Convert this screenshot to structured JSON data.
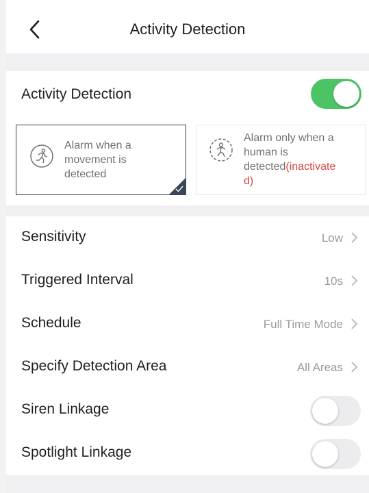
{
  "header": {
    "title": "Activity Detection",
    "back_icon": "chevron-left-icon"
  },
  "activity_detection": {
    "label": "Activity Detection",
    "enabled": true,
    "toggle_color": "#4cc466",
    "modes": [
      {
        "text_line1": "Alarm when a",
        "text_line2": "movement is",
        "text_line3": "detected",
        "selected": true,
        "icon": "running-person-icon"
      },
      {
        "text_line1": "Alarm only when a",
        "text_line2": "human  is",
        "text_line3a": "detected",
        "text_line3b": "(inactivate",
        "text_line4": "d)",
        "selected": false,
        "icon": "human-detect-icon",
        "inactive_color": "#d9463e"
      }
    ]
  },
  "settings": {
    "sensitivity": {
      "label": "Sensitivity",
      "value": "Low"
    },
    "triggered_interval": {
      "label": "Triggered Interval",
      "value": "10s"
    },
    "schedule": {
      "label": "Schedule",
      "value": "Full Time Mode"
    },
    "detection_area": {
      "label": "Specify Detection Area",
      "value": "All Areas"
    },
    "siren_linkage": {
      "label": "Siren Linkage",
      "enabled": false
    },
    "spotlight_linkage": {
      "label": "Spotlight Linkage",
      "enabled": false
    }
  }
}
